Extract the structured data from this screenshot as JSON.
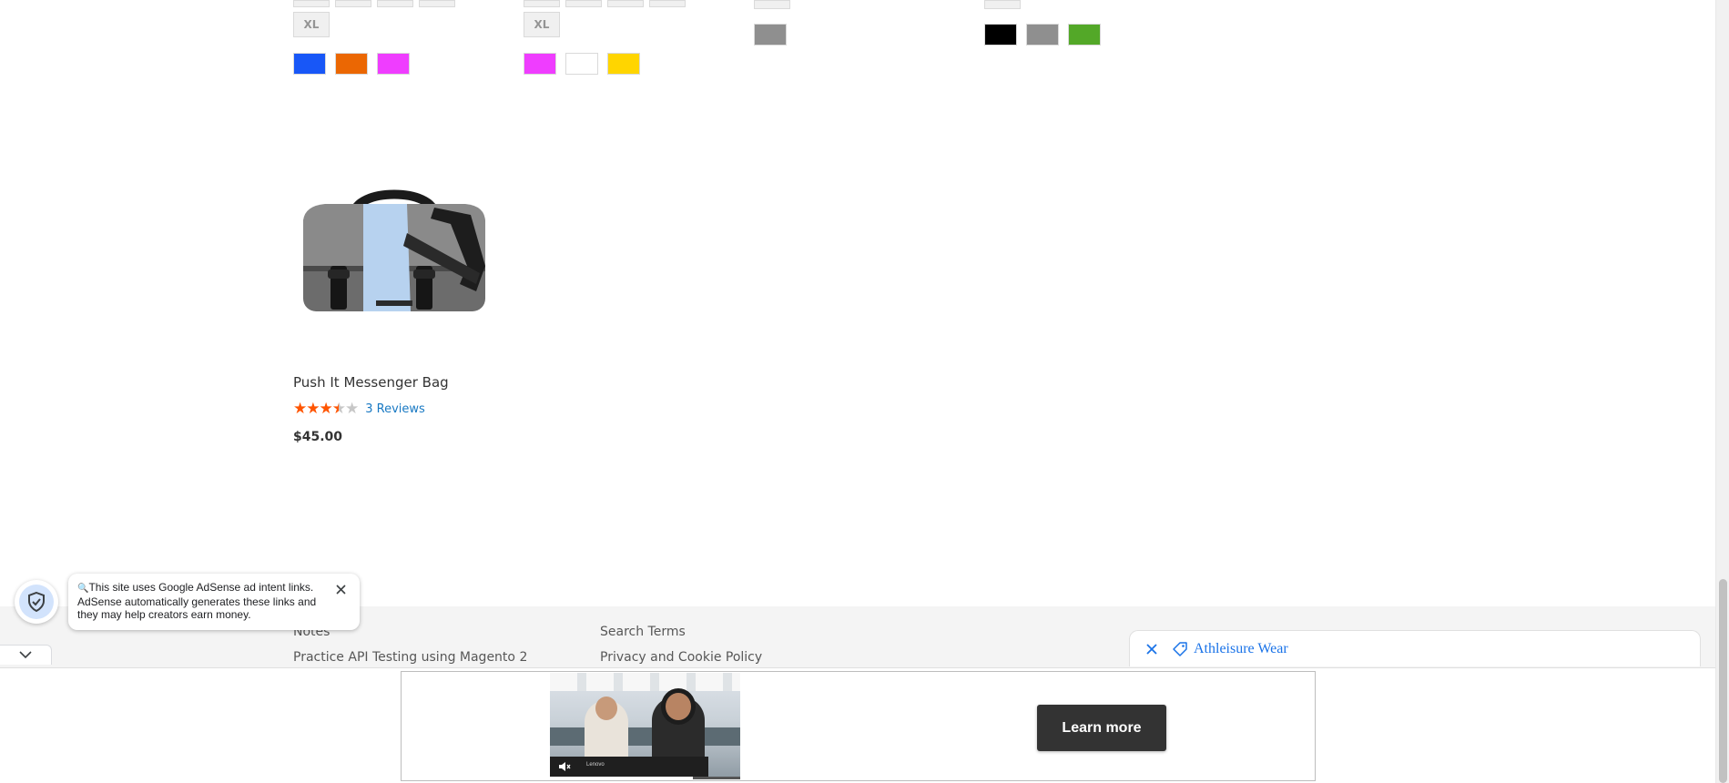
{
  "colors": {
    "accent_link": "#1979c3",
    "star": "#ff5501",
    "footer_bg": "#f4f4f4",
    "tag_link": "#1a73e8",
    "button_dark": "#333333"
  },
  "product_grid": {
    "size_swatches": [
      {
        "label": "XL"
      },
      {
        "label": "XL"
      }
    ],
    "color_swatch_colors": [
      {
        "color": "#1857f7"
      },
      {
        "color": "#eb6703"
      },
      {
        "color": "#ef3dff"
      },
      {
        "color": "#ef3dff"
      },
      {
        "color": "#ffffff"
      },
      {
        "color": "#ffd500"
      },
      {
        "color": "#8f8f8f"
      },
      {
        "color": "#000000"
      },
      {
        "color": "#8f8f8f"
      },
      {
        "color": "#53a828"
      }
    ]
  },
  "product": {
    "name": "Push It Messenger Bag",
    "rating_percent": 70,
    "reviews": "3 Reviews",
    "price": "$45.00",
    "image_icon": "messenger-bag-image"
  },
  "footer": {
    "links": [
      {
        "label": "Notes"
      },
      {
        "label": "Practice API Testing using Magento 2"
      },
      {
        "label": "Search Terms"
      },
      {
        "label": "Privacy and Cookie Policy"
      }
    ]
  },
  "adsense": {
    "notice_line1": "This site uses Google AdSense ad intent links.",
    "notice_line2": "AdSense automatically generates these links and they may help creators earn money.",
    "shield_icon": "shield-check-icon",
    "close_icon": "close-icon",
    "collapse_icon": "chevron-down-icon"
  },
  "tag_widget": {
    "label": "Athleisure Wear",
    "close_icon": "close-icon",
    "tag_icon": "tag-icon"
  },
  "ad": {
    "cta": "Learn more",
    "video_brand": "Lenovo",
    "video_progress_percent": 75
  }
}
